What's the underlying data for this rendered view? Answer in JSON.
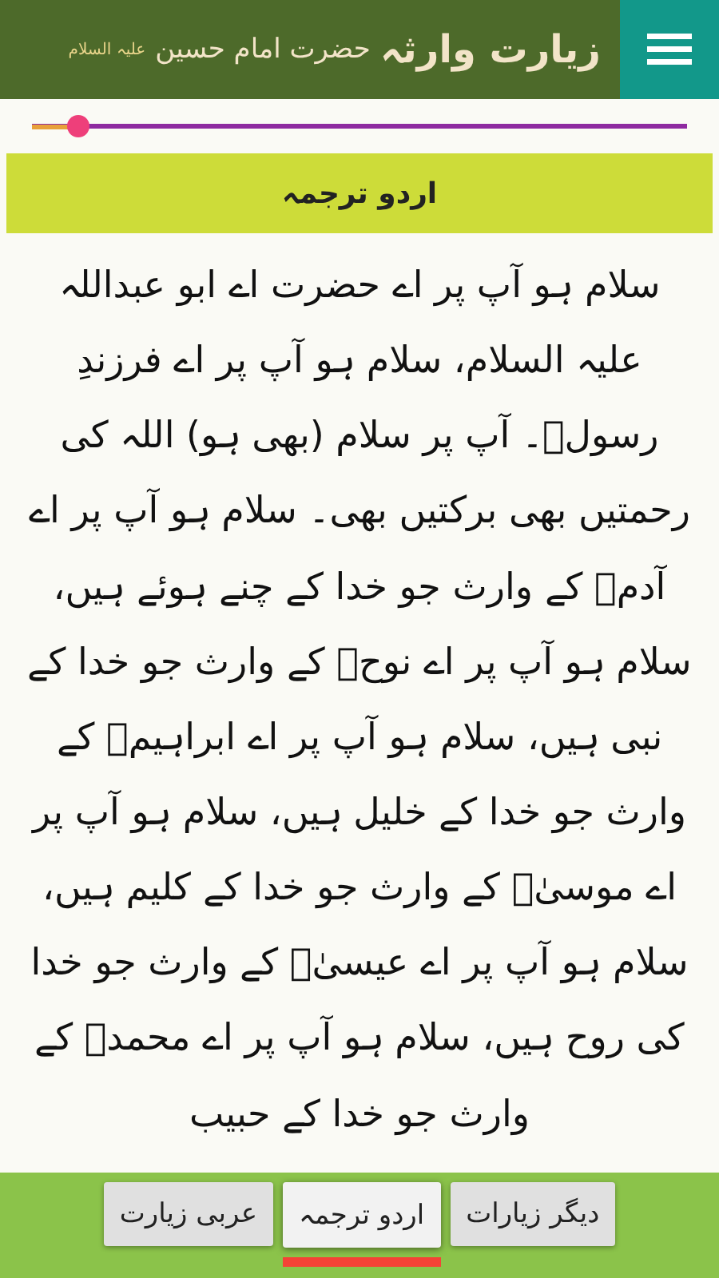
{
  "header": {
    "title_main": "زیارت وارثہ",
    "title_sub": "حضرت امام حسین",
    "title_honorific": "علیہ السلام"
  },
  "progress": {
    "level": 0.07
  },
  "section": {
    "title": "اردو ترجمہ"
  },
  "body": {
    "text": "سلام ہو آپ پر اے حضرت اے ابو عبداللہ علیہ السلام، سلام ہو آپ پر اے فرزندِ رسولؐ۔ آپ پر سلام (بھی ہو) اللہ کی رحمتیں بھی برکتیں بھی۔ سلام ہو آپ پر اے آدمؑ کے وارث جو خدا کے چنے ہوئے ہیں، سلام ہو آپ پر اے نوحؑ کے وارث جو خدا کے نبی ہیں، سلام ہو آپ پر اے ابراہیمؑ کے وارث جو خدا کے خلیل ہیں، سلام ہو آپ پر اے موسیٰؑ کے وارث جو خدا کے کلیم ہیں، سلام ہو آپ پر اے عیسیٰؑ کے وارث جو خدا کی روح ہیں، سلام ہو آپ پر اے محمدؐ کے وارث جو خدا کے حبیب"
  },
  "tabs": [
    {
      "label": "دیگر زیارات",
      "selected": false
    },
    {
      "label": "اردو ترجمہ",
      "selected": true
    },
    {
      "label": "عربی زیارت",
      "selected": false
    }
  ]
}
